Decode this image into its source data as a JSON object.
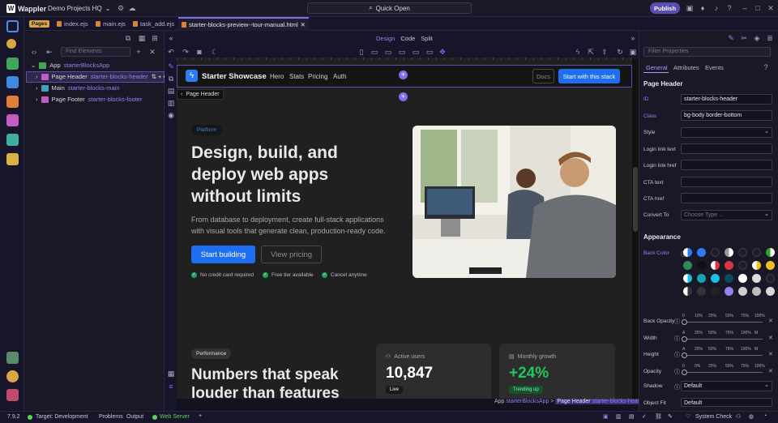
{
  "app": {
    "name": "Wappler",
    "project": "Demo Projects HQ",
    "quick_open": "Quick Open",
    "publish": "Publish"
  },
  "tabs": {
    "pages_badge": "Pages",
    "items": [
      "index.ejs",
      "main.ejs",
      "task_add.ejs",
      "starter-blocks-preview--tour-manual.html"
    ]
  },
  "tree": {
    "find_placeholder": "Find Elements",
    "rows": [
      {
        "label": "App",
        "cls": "starterBlocksApp"
      },
      {
        "label": "Page Header",
        "cls": "starter-blocks-header"
      },
      {
        "label": "Main",
        "cls": "starter-blocks-main"
      },
      {
        "label": "Page Footer",
        "cls": "starter-blocks-footer"
      }
    ]
  },
  "design_modes": [
    "Design",
    "Code",
    "Split"
  ],
  "canvas": {
    "brand": "Starter Showcase",
    "nav": [
      "Hero",
      "Stats",
      "Pricing",
      "Auth"
    ],
    "docs": "Docs",
    "cta": "Start with this stack",
    "selected_label": "Page Header",
    "badge": "Platform",
    "headline": "Design, build, and deploy web apps without limits",
    "subtext": "From database to deployment, create full-stack applications with visual tools that generate clean, production-ready code.",
    "btn_primary": "Start building",
    "btn_secondary": "View pricing",
    "checks": [
      "No credit card required",
      "Free tier available",
      "Cancel anytime"
    ],
    "badge2": "Performance",
    "headline2": "Numbers that speak louder than features",
    "stats": [
      {
        "label": "Active users",
        "value": "10,847",
        "chip": "Live",
        "color": "#ffffff"
      },
      {
        "label": "Monthly growth",
        "value": "+24%",
        "chip": "Trending up",
        "color": "#22c55e"
      }
    ]
  },
  "breadcrumb": {
    "app": "App",
    "app_cls": "starterBlocksApp",
    "sel": "Page Header",
    "sel_cls": "starter-blocks-header"
  },
  "props": {
    "filter_placeholder": "Filter Properties",
    "tabs": [
      "General",
      "Attributes",
      "Events"
    ],
    "section1": "Page Header",
    "fields": [
      {
        "label": "ID",
        "value": "starter-blocks-header"
      },
      {
        "label": "Class",
        "value": "bg-body border-bottom"
      },
      {
        "label": "Style",
        "value": ""
      },
      {
        "label": "Login link text",
        "value": ""
      },
      {
        "label": "Login link href",
        "value": ""
      },
      {
        "label": "CTA text",
        "value": ""
      },
      {
        "label": "CTA href",
        "value": ""
      },
      {
        "label": "Convert To",
        "value": "Choose Type ..."
      }
    ],
    "section2": "Appearance",
    "back_color": "Back Color",
    "sliders": [
      {
        "label": "Back Opacity",
        "ticks": [
          "0",
          "10%",
          "25%",
          "50%",
          "75%",
          "100%"
        ]
      },
      {
        "label": "Width",
        "ticks": [
          "A",
          "25%",
          "50%",
          "75%",
          "100%",
          "M"
        ]
      },
      {
        "label": "Height",
        "ticks": [
          "A",
          "25%",
          "50%",
          "75%",
          "100%",
          "M"
        ]
      },
      {
        "label": "Opacity",
        "ticks": [
          "0",
          "0%",
          "25%",
          "50%",
          "75%",
          "100%"
        ]
      }
    ],
    "shadow": {
      "label": "Shadow",
      "value": "Default"
    },
    "object_fit": {
      "label": "Object Fit",
      "value": "Default"
    }
  },
  "status": {
    "version": "7.9.2",
    "target": "Target: Development",
    "problems": "Problems",
    "output": "Output",
    "web_server": "Web Server",
    "system_check": "System Check"
  }
}
